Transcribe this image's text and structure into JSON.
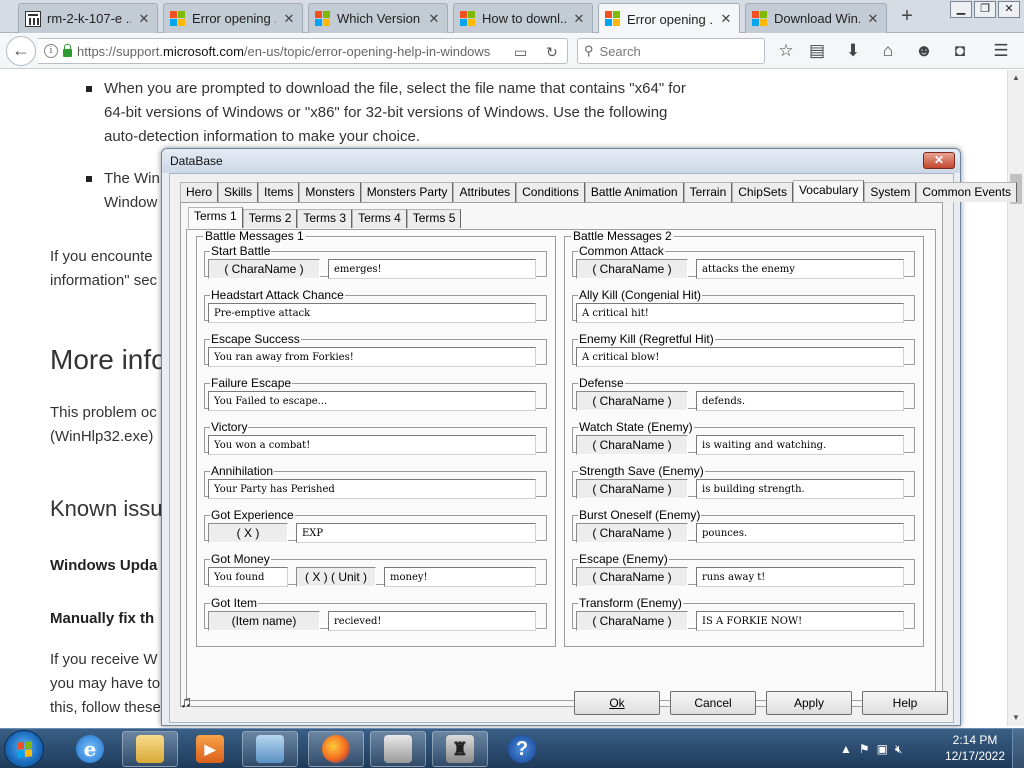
{
  "browser": {
    "tabs": [
      {
        "title": "rm-2-k-107-e ...",
        "favicon": "library-icon",
        "active": false
      },
      {
        "title": "Error opening ...",
        "favicon": "microsoft-icon",
        "active": false
      },
      {
        "title": "Which Version...",
        "favicon": "microsoft-icon",
        "active": false
      },
      {
        "title": "How to downl...",
        "favicon": "microsoft-icon",
        "active": false
      },
      {
        "title": "Error opening ...",
        "favicon": "microsoft-icon",
        "active": true
      },
      {
        "title": "Download Win...",
        "favicon": "microsoft-icon",
        "active": false
      }
    ],
    "url_prefix": "https://support.",
    "url_domain": "microsoft.com",
    "url_suffix": "/en-us/topic/error-opening-help-in-windows",
    "search_placeholder": "Search"
  },
  "webpage": {
    "bullet1_line1": "When you are prompted to download the file, select the file name that contains \"x64\" for",
    "bullet1_line2": "64-bit versions of Windows or \"x86\" for 32-bit versions of Windows. Use the following",
    "bullet1_line3": "auto-detection information to make your choice.",
    "bullet2_line1": "The Win",
    "bullet2_line2": "Window",
    "para1_line1": "If you encounte",
    "para1_line2": "information\" sec",
    "more_info_heading": "More info",
    "para2_line1": "This problem oc",
    "para2_line2": "(WinHlp32.exe)",
    "known_issues_heading": "Known issu",
    "windows_update_heading": "Windows Upda",
    "manually_fix_heading": "Manually fix th",
    "para3_line1": "If you receive W",
    "para3_line2": "you may have to",
    "para3_line3": "this, follow these"
  },
  "dialog": {
    "title": "DataBase",
    "top_tabs": [
      "Hero",
      "Skills",
      "Items",
      "Monsters",
      "Monsters Party",
      "Attributes",
      "Conditions",
      "Battle Animation",
      "Terrain",
      "ChipSets",
      "Vocabulary",
      "System",
      "Common Events"
    ],
    "active_top_tab": "Vocabulary",
    "sub_tabs": [
      "Terms 1",
      "Terms 2",
      "Terms 3",
      "Terms 4",
      "Terms 5"
    ],
    "active_sub_tab": "Terms 1",
    "group1": {
      "title": "Battle Messages 1",
      "start_battle": {
        "label": "Start Battle",
        "placeholder": "( CharaName )",
        "value": "emerges!"
      },
      "headstart": {
        "label": "Headstart Attack Chance",
        "value": "Pre-emptive attack"
      },
      "escape_success": {
        "label": "Escape Success",
        "value": "You ran away from Forkies!"
      },
      "failure_escape": {
        "label": "Failure Escape",
        "value": "You Failed to escape..."
      },
      "victory": {
        "label": "Victory",
        "value": "You won a combat!"
      },
      "annihilation": {
        "label": "Annihilation",
        "value": "Your Party has Perished"
      },
      "got_experience": {
        "label": "Got Experience",
        "placeholder": "( X )",
        "value": "EXP"
      },
      "got_money": {
        "label": "Got Money",
        "value1": "You found",
        "placeholder": "( X ) ( Unit )",
        "value2": "money!"
      },
      "got_item": {
        "label": "Got Item",
        "placeholder": "(Item name)",
        "value": "recieved!"
      }
    },
    "group2": {
      "title": "Battle Messages 2",
      "common_attack": {
        "label": "Common Attack",
        "placeholder": "( CharaName )",
        "value": "attacks the enemy"
      },
      "ally_kill": {
        "label": "Ally Kill (Congenial Hit)",
        "value": "A critical hit!"
      },
      "enemy_kill": {
        "label": "Enemy Kill (Regretful Hit)",
        "value": "A critical blow!"
      },
      "defense": {
        "label": "Defense",
        "placeholder": "( CharaName )",
        "value": "defends."
      },
      "watch_state": {
        "label": "Watch State (Enemy)",
        "placeholder": "( CharaName )",
        "value": "is waiting and watching."
      },
      "strength_save": {
        "label": "Strength Save (Enemy)",
        "placeholder": "( CharaName )",
        "value": "is building strength."
      },
      "burst_oneself": {
        "label": "Burst Oneself (Enemy)",
        "placeholder": "( CharaName )",
        "value": "pounces."
      },
      "escape_enemy": {
        "label": "Escape (Enemy)",
        "placeholder": "( CharaName )",
        "value": "runs away t!"
      },
      "transform_enemy": {
        "label": "Transform (Enemy)",
        "placeholder": "( CharaName )",
        "value": "IS A FORKIE NOW!"
      }
    },
    "buttons": {
      "ok": "Ok",
      "cancel": "Cancel",
      "apply": "Apply",
      "help": "Help"
    }
  },
  "taskbar": {
    "time": "2:14 PM",
    "date": "12/17/2022"
  }
}
